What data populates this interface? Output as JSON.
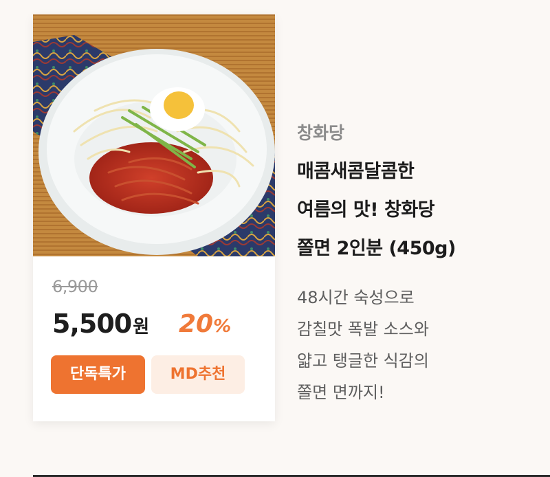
{
  "product": {
    "image_alt": "쫄면",
    "original_price": "6,900",
    "price": "5,500",
    "currency": "원",
    "discount_number": "20",
    "discount_symbol": "%",
    "badges": [
      "단독특가",
      "MD추천"
    ],
    "brand": "창화당",
    "title_lines": [
      "매콤새콤달콤한",
      "여름의 맛! 창화당",
      "쫄면 2인분 (450g)"
    ],
    "description_lines": [
      "48시간 숙성으로",
      "감칠맛 폭발 소스와",
      "얇고 탱글한 식감의",
      "쫄면 면까지!"
    ]
  },
  "colors": {
    "accent": "#ee7330",
    "accent_light": "#fdeee4",
    "background": "#fbf8f5"
  }
}
